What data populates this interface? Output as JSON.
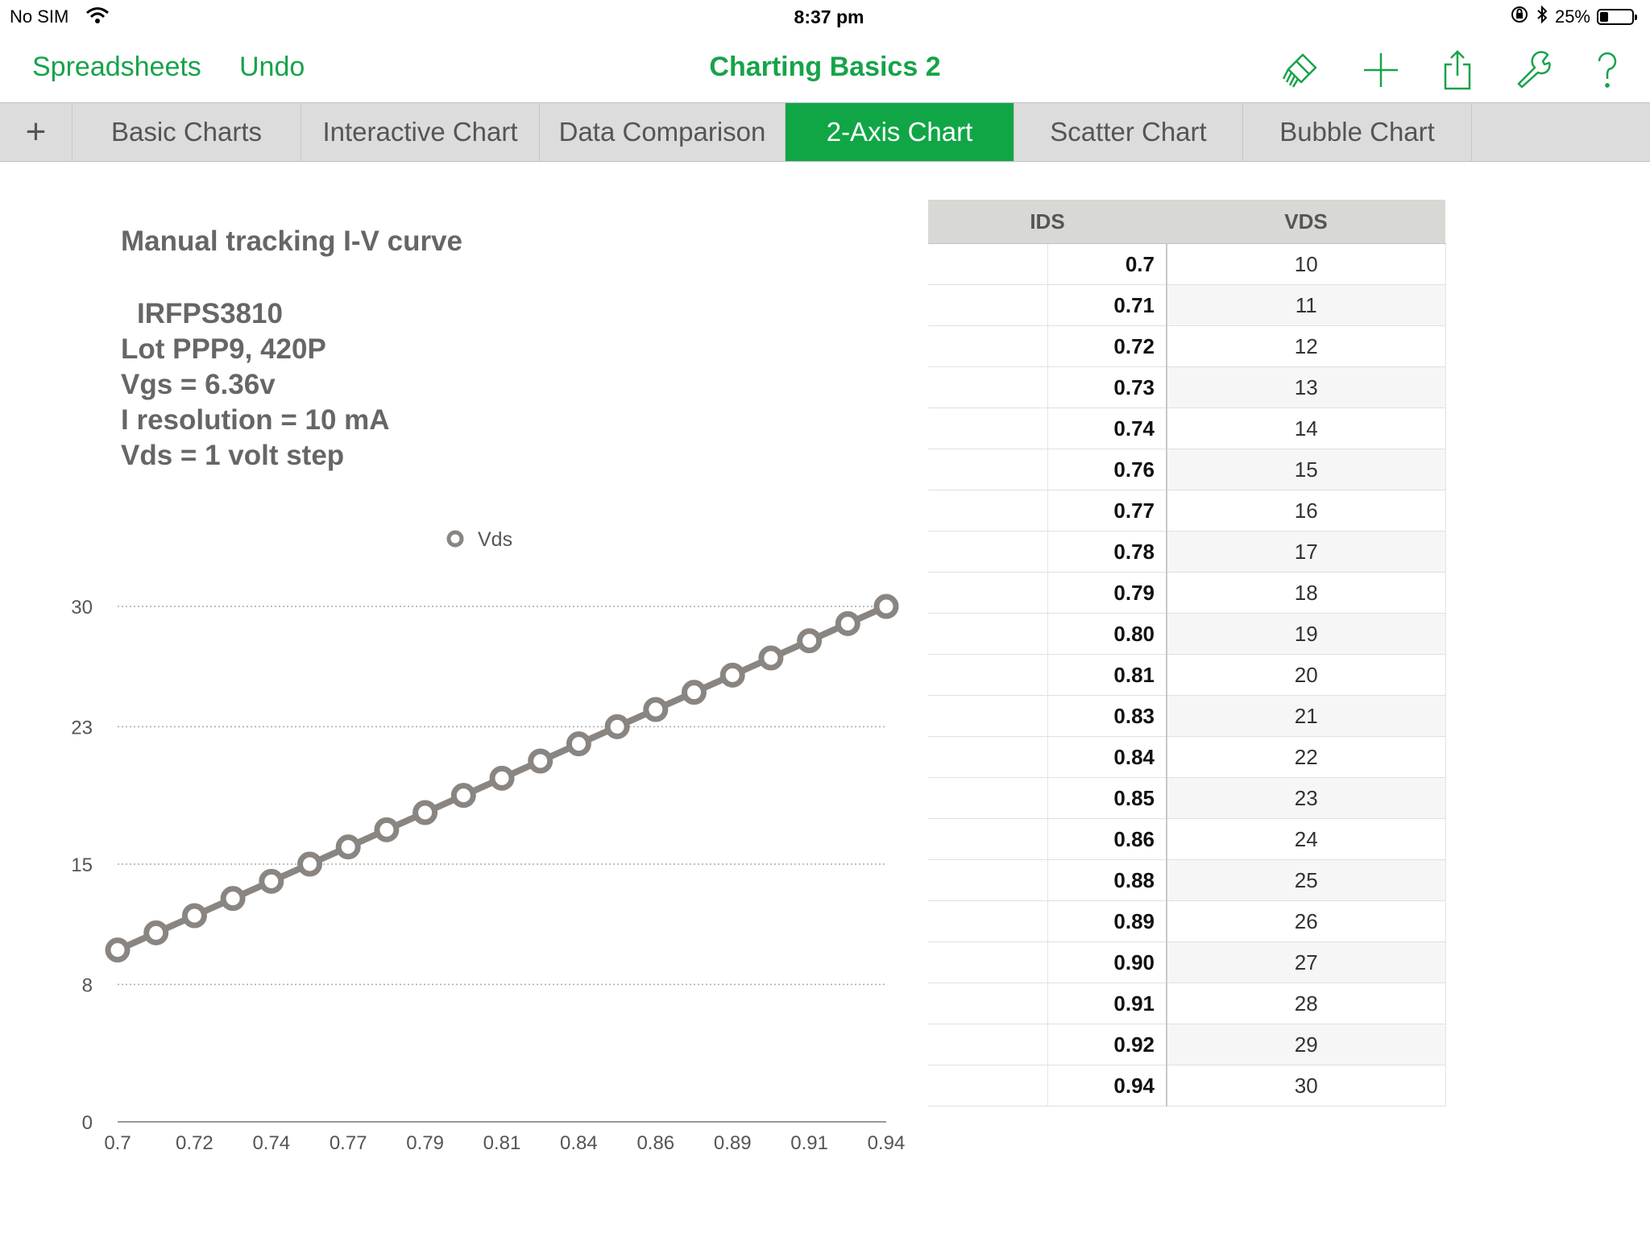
{
  "status_bar": {
    "carrier": "No SIM",
    "time": "8:37 pm",
    "battery": "25%",
    "battery_level": 0.25
  },
  "toolbar": {
    "spreadsheets_label": "Spreadsheets",
    "undo_label": "Undo",
    "title": "Charting Basics 2",
    "icons": [
      "paintbrush-icon",
      "plus-icon",
      "share-icon",
      "wrench-icon",
      "help-icon"
    ]
  },
  "tabs": [
    {
      "label": "+"
    },
    {
      "label": "Basic Charts"
    },
    {
      "label": "Interactive Chart"
    },
    {
      "label": "Data Comparison"
    },
    {
      "label": "2-Axis Chart",
      "active": true
    },
    {
      "label": "Scatter Chart"
    },
    {
      "label": "Bubble Chart"
    }
  ],
  "info": {
    "title": "Manual tracking I-V curve",
    "lines": [
      "IRFPS3810",
      "Lot PPP9, 420P",
      "Vgs = 6.36v",
      "I resolution = 10 mA",
      "Vds = 1 volt step"
    ]
  },
  "colors": {
    "accent": "#10a646",
    "series": "#8a8580"
  },
  "table": {
    "headers": [
      "IDS",
      "VDS"
    ],
    "rows": [
      [
        "0.7",
        "10"
      ],
      [
        "0.71",
        "11"
      ],
      [
        "0.72",
        "12"
      ],
      [
        "0.73",
        "13"
      ],
      [
        "0.74",
        "14"
      ],
      [
        "0.76",
        "15"
      ],
      [
        "0.77",
        "16"
      ],
      [
        "0.78",
        "17"
      ],
      [
        "0.79",
        "18"
      ],
      [
        "0.80",
        "19"
      ],
      [
        "0.81",
        "20"
      ],
      [
        "0.83",
        "21"
      ],
      [
        "0.84",
        "22"
      ],
      [
        "0.85",
        "23"
      ],
      [
        "0.86",
        "24"
      ],
      [
        "0.88",
        "25"
      ],
      [
        "0.89",
        "26"
      ],
      [
        "0.90",
        "27"
      ],
      [
        "0.91",
        "28"
      ],
      [
        "0.92",
        "29"
      ],
      [
        "0.94",
        "30"
      ]
    ]
  },
  "chart_data": {
    "type": "line",
    "title": "",
    "xlabel": "",
    "ylabel": "",
    "x_tick_labels": [
      "0.7",
      "0.72",
      "0.74",
      "0.77",
      "0.79",
      "0.81",
      "0.84",
      "0.86",
      "0.89",
      "0.91",
      "0.94"
    ],
    "y_ticks": [
      0,
      8,
      15,
      23,
      30
    ],
    "ylim": [
      0,
      30
    ],
    "legend": "top-center",
    "grid": true,
    "series": [
      {
        "name": "Vds",
        "x": [
          0.7,
          0.71,
          0.72,
          0.73,
          0.74,
          0.76,
          0.77,
          0.78,
          0.79,
          0.8,
          0.81,
          0.83,
          0.84,
          0.85,
          0.86,
          0.88,
          0.89,
          0.9,
          0.91,
          0.92,
          0.94
        ],
        "values": [
          10,
          11,
          12,
          13,
          14,
          15,
          16,
          17,
          18,
          19,
          20,
          21,
          22,
          23,
          24,
          25,
          26,
          27,
          28,
          29,
          30
        ]
      }
    ]
  }
}
